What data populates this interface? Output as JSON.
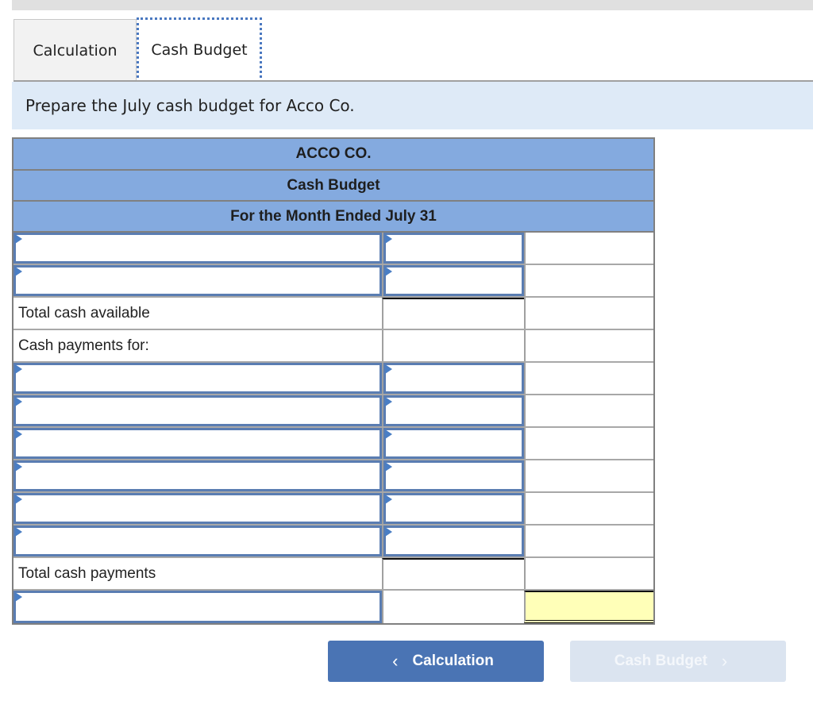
{
  "tabs": [
    {
      "label": "Calculation",
      "active": false
    },
    {
      "label": "Cash Budget",
      "active": true
    }
  ],
  "instruction": "Prepare the July cash budget for Acco Co.",
  "budget": {
    "company": "ACCO CO.",
    "title": "Cash Budget",
    "period": "For the Month Ended July 31",
    "labels": {
      "total_cash_available": "Total cash available",
      "cash_payments_for": "Cash payments for:",
      "total_cash_payments": "Total cash payments"
    },
    "colors": {
      "header": "#84aadf",
      "highlight": "#ffffb8",
      "input_border": "#5a7db2"
    }
  },
  "nav": {
    "prev_label": "Calculation",
    "next_label": "Cash Budget",
    "prev_icon": "chevron-left-icon",
    "next_icon": "chevron-right-icon"
  }
}
